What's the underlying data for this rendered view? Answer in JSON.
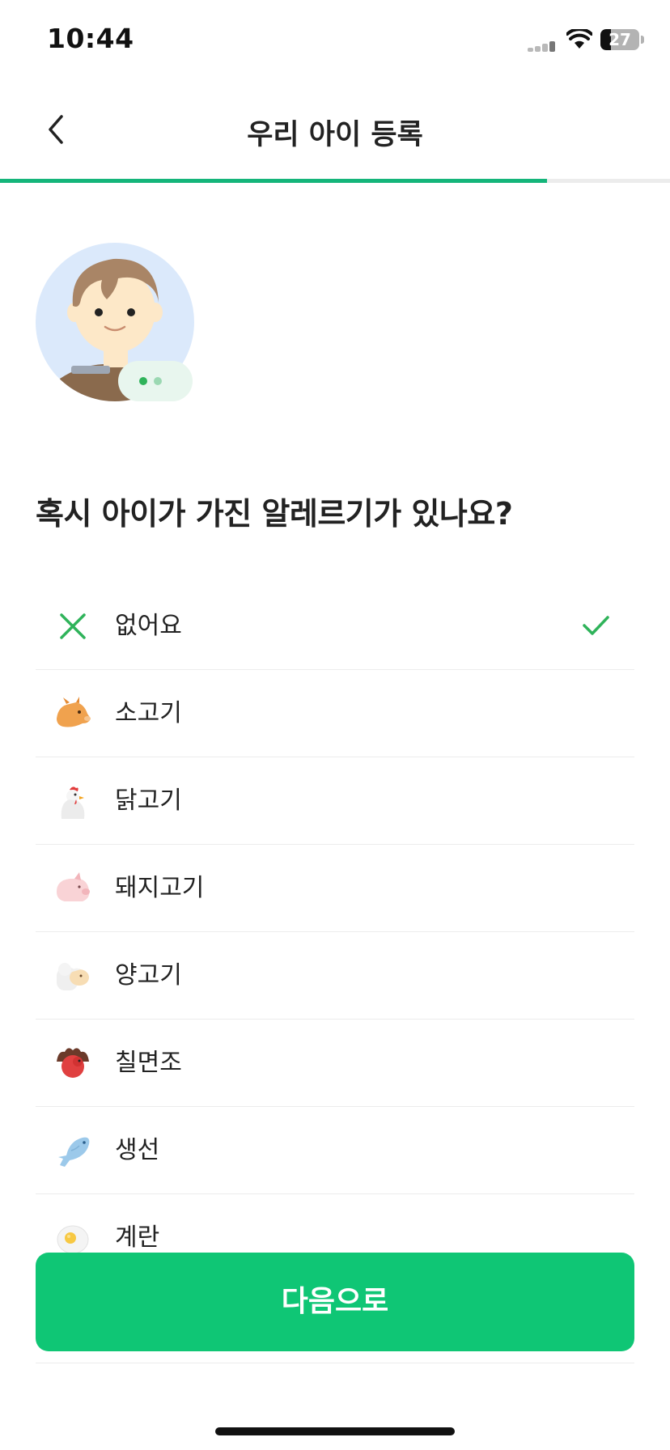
{
  "status": {
    "time": "10:44",
    "battery": "27",
    "battery_level": 0.27
  },
  "nav": {
    "title": "우리 아이 등록",
    "back_icon": "chevron-left-icon"
  },
  "progress": {
    "fraction": 0.817,
    "color": "#14b57a"
  },
  "question": "혹시 아이가 가진 알레르기가 있나요?",
  "allergy_options": [
    {
      "label": "없어요",
      "icon": "close-icon",
      "selected": true
    },
    {
      "label": "소고기",
      "icon": "cow-icon",
      "selected": false
    },
    {
      "label": "닭고기",
      "icon": "chicken-icon",
      "selected": false
    },
    {
      "label": "돼지고기",
      "icon": "pig-icon",
      "selected": false
    },
    {
      "label": "양고기",
      "icon": "sheep-icon",
      "selected": false
    },
    {
      "label": "칠면조",
      "icon": "turkey-icon",
      "selected": false
    },
    {
      "label": "생선",
      "icon": "fish-icon",
      "selected": false
    },
    {
      "label": "계란",
      "icon": "egg-icon",
      "selected": false
    }
  ],
  "next_button": "다음으로",
  "colors": {
    "accent": "#0fc675",
    "check": "#2fb35a"
  }
}
